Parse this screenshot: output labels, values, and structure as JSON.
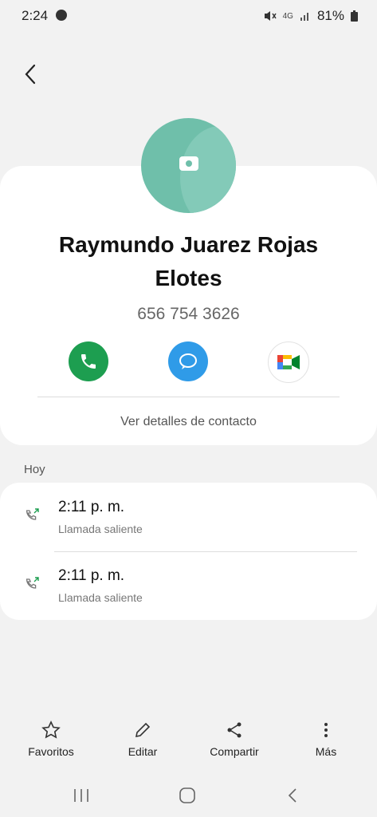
{
  "status": {
    "time": "2:24",
    "network": "4G",
    "battery": "81%"
  },
  "contact": {
    "name_line1": "Raymundo Juarez Rojas",
    "name_line2": "Elotes",
    "phone": "656 754 3626",
    "details_link": "Ver detalles de contacto"
  },
  "history": {
    "section_label": "Hoy",
    "entries": [
      {
        "time": "2:11 p. m.",
        "type": "Llamada saliente"
      },
      {
        "time": "2:11 p. m.",
        "type": "Llamada saliente"
      }
    ]
  },
  "bottom_actions": {
    "favorites": "Favoritos",
    "edit": "Editar",
    "share": "Compartir",
    "more": "Más"
  },
  "colors": {
    "call": "#1d9e50",
    "message": "#2f9be8",
    "avatar": "#6fbfaa"
  }
}
